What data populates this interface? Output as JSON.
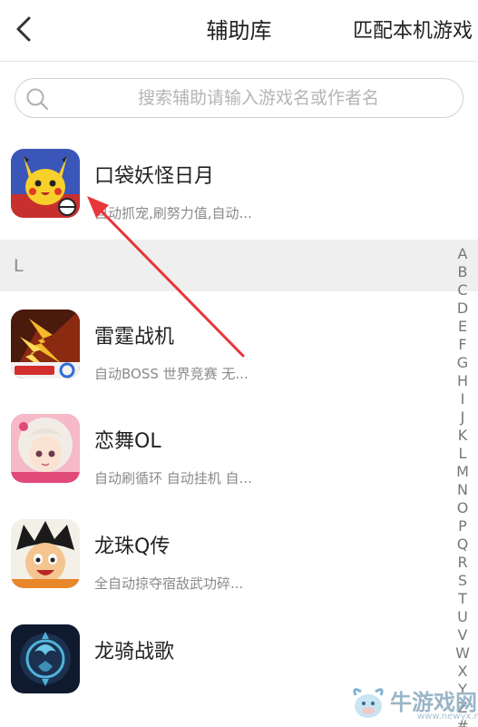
{
  "header": {
    "title": "辅助库",
    "match_label": "匹配本机游戏"
  },
  "search": {
    "placeholder": "搜索辅助请输入游戏名或作者名",
    "value": ""
  },
  "section_letter": "L",
  "games": [
    {
      "name": "口袋妖怪日月",
      "desc": "自动抓宠,刷努力值,自动...",
      "icon": "pikachu-icon"
    },
    {
      "name": "雷霆战机",
      "desc": "自动BOSS 世界竞赛 无...",
      "icon": "fighter-jet-icon"
    },
    {
      "name": "恋舞OL",
      "desc": "自动刷循环 自动挂机 自...",
      "icon": "anime-girl-icon"
    },
    {
      "name": "龙珠Q传",
      "desc": "全自动掠夺宿敌武功碎...",
      "icon": "goku-icon"
    },
    {
      "name": "龙骑战歌",
      "desc": "",
      "icon": "dragon-emblem-icon"
    }
  ],
  "index_letters": [
    "A",
    "B",
    "C",
    "D",
    "E",
    "F",
    "G",
    "H",
    "I",
    "J",
    "K",
    "L",
    "M",
    "N",
    "O",
    "P",
    "Q",
    "R",
    "S",
    "T",
    "U",
    "V",
    "W",
    "X",
    "Y",
    "Z",
    "#"
  ],
  "watermark": {
    "text": "牛游戏网",
    "url": "www.newyx.net"
  },
  "colors": {
    "annotation_arrow": "#e8363a",
    "section_bg": "#efefef",
    "secondary_text": "#8a8a8a"
  }
}
